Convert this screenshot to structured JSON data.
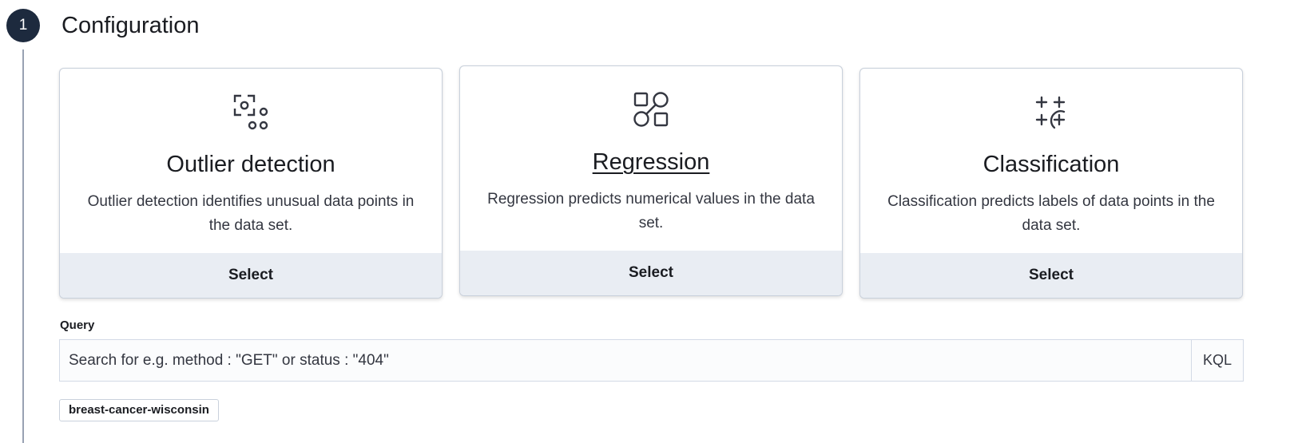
{
  "step": {
    "number": "1",
    "title": "Configuration"
  },
  "cards": [
    {
      "title": "Outlier detection",
      "description": "Outlier detection identifies unusual data points in the data set.",
      "select_label": "Select",
      "icon": "outlier-detection-icon"
    },
    {
      "title": "Regression",
      "description": "Regression predicts numerical values in the data set.",
      "select_label": "Select",
      "icon": "regression-icon"
    },
    {
      "title": "Classification",
      "description": "Classification predicts labels of data points in the data set.",
      "select_label": "Select",
      "icon": "classification-icon"
    }
  ],
  "query": {
    "label": "Query",
    "placeholder": "Search for e.g. method : \"GET\" or status : \"404\"",
    "language_button": "KQL"
  },
  "index_badge": "breast-cancer-wisconsin",
  "colors": {
    "step_circle": "#1d2a3e",
    "card_footer": "#e9edf3",
    "text": "#1a1c21"
  }
}
